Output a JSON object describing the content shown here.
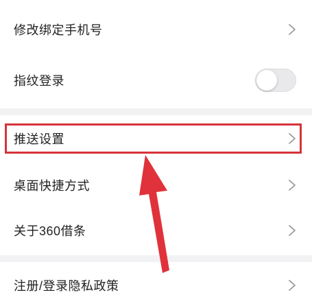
{
  "settings": {
    "change_phone": {
      "label": "修改绑定手机号",
      "icon": "chevron-right-icon"
    },
    "fingerprint_login": {
      "label": "指纹登录",
      "enabled": false
    },
    "push_settings": {
      "label": "推送设置",
      "icon": "chevron-right-icon"
    },
    "desktop_shortcut": {
      "label": "桌面快捷方式",
      "icon": "chevron-right-icon"
    },
    "about": {
      "label": "关于360借条",
      "icon": "chevron-right-icon"
    },
    "privacy_policy": {
      "label": "注册/登录隐私政策",
      "icon": "chevron-right-icon"
    }
  },
  "annotation": {
    "highlight_color": "#d6323a",
    "arrow_color": "#e0323b"
  },
  "colors": {
    "background": "#f2f2f4",
    "row_background": "#ffffff",
    "text": "#222222",
    "chevron": "#9a9a9a"
  }
}
